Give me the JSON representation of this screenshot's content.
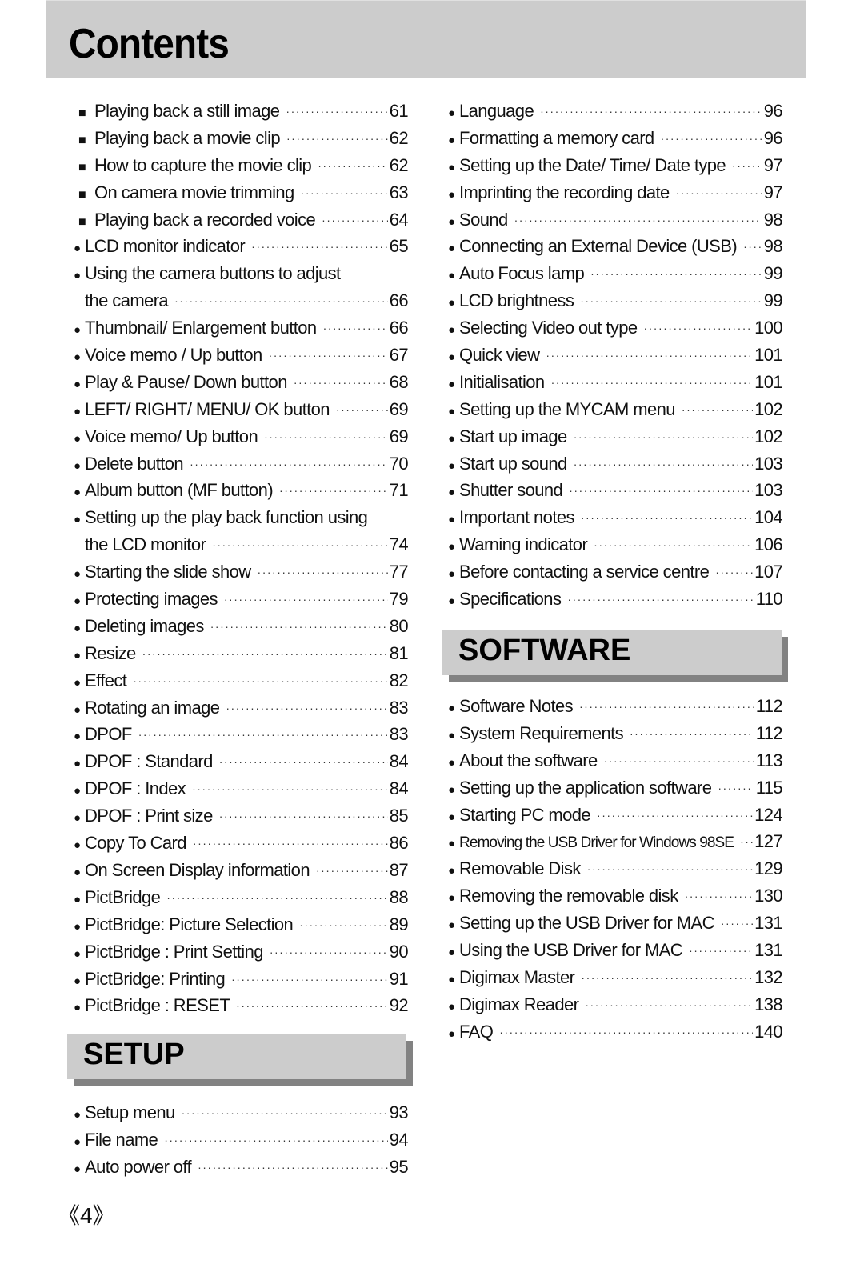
{
  "title": "Contents",
  "left_column": [
    {
      "label": "Playing back a still image",
      "page": "61",
      "bullet": "square"
    },
    {
      "label": "Playing back a movie clip",
      "page": "62",
      "bullet": "square"
    },
    {
      "label": "How to capture the movie clip",
      "page": "62",
      "bullet": "square"
    },
    {
      "label": "On camera movie trimming",
      "page": "63",
      "bullet": "square"
    },
    {
      "label": "Playing back a recorded voice",
      "page": "64",
      "bullet": "square"
    },
    {
      "label": "LCD monitor indicator",
      "page": "65",
      "bullet": "circle"
    },
    {
      "label": "Using the camera buttons to adjust",
      "page": "",
      "bullet": "circle"
    },
    {
      "label": "the camera",
      "page": "66",
      "bullet": "cont"
    },
    {
      "label": "Thumbnail/ Enlargement button",
      "page": "66",
      "bullet": "circle"
    },
    {
      "label": "Voice memo / Up button",
      "page": "67",
      "bullet": "circle"
    },
    {
      "label": "Play & Pause/ Down button",
      "page": "68",
      "bullet": "circle"
    },
    {
      "label": "LEFT/ RIGHT/ MENU/ OK button",
      "page": "69",
      "bullet": "circle"
    },
    {
      "label": "Voice memo/ Up button",
      "page": "69",
      "bullet": "circle"
    },
    {
      "label": "Delete button",
      "page": "70",
      "bullet": "circle"
    },
    {
      "label": "Album button (MF button)",
      "page": "71",
      "bullet": "circle"
    },
    {
      "label": "Setting up the play back function using",
      "page": "",
      "bullet": "circle"
    },
    {
      "label": "the LCD monitor",
      "page": "74",
      "bullet": "cont"
    },
    {
      "label": "Starting the slide show",
      "page": "77",
      "bullet": "circle"
    },
    {
      "label": "Protecting images",
      "page": "79",
      "bullet": "circle"
    },
    {
      "label": "Deleting images",
      "page": "80",
      "bullet": "circle"
    },
    {
      "label": "Resize",
      "page": "81",
      "bullet": "circle"
    },
    {
      "label": "Effect",
      "page": "82",
      "bullet": "circle"
    },
    {
      "label": "Rotating an image",
      "page": "83",
      "bullet": "circle"
    },
    {
      "label": "DPOF",
      "page": "83",
      "bullet": "circle"
    },
    {
      "label": "DPOF : Standard",
      "page": "84",
      "bullet": "circle"
    },
    {
      "label": "DPOF : Index",
      "page": "84",
      "bullet": "circle"
    },
    {
      "label": "DPOF : Print size",
      "page": "85",
      "bullet": "circle"
    },
    {
      "label": "Copy To Card",
      "page": "86",
      "bullet": "circle"
    },
    {
      "label": "On Screen Display information",
      "page": "87",
      "bullet": "circle"
    },
    {
      "label": "PictBridge",
      "page": "88",
      "bullet": "circle"
    },
    {
      "label": "PictBridge: Picture Selection",
      "page": "89",
      "bullet": "circle"
    },
    {
      "label": "PictBridge : Print Setting",
      "page": "90",
      "bullet": "circle"
    },
    {
      "label": "PictBridge: Printing",
      "page": "91",
      "bullet": "circle"
    },
    {
      "label": "PictBridge : RESET",
      "page": "92",
      "bullet": "circle"
    }
  ],
  "setup": {
    "heading": "SETUP",
    "items": [
      {
        "label": "Setup menu",
        "page": "93"
      },
      {
        "label": "File name",
        "page": "94"
      },
      {
        "label": "Auto power off",
        "page": "95"
      }
    ]
  },
  "right_column": [
    {
      "label": "Language",
      "page": "96"
    },
    {
      "label": "Formatting a memory card",
      "page": "96"
    },
    {
      "label": "Setting up the Date/ Time/ Date type",
      "page": "97"
    },
    {
      "label": "Imprinting the recording date",
      "page": "97"
    },
    {
      "label": "Sound",
      "page": "98"
    },
    {
      "label": "Connecting an External Device (USB)",
      "page": "98"
    },
    {
      "label": "Auto Focus lamp",
      "page": "99"
    },
    {
      "label": "LCD brightness",
      "page": "99"
    },
    {
      "label": "Selecting Video out type",
      "page": "100"
    },
    {
      "label": "Quick view",
      "page": "101"
    },
    {
      "label": "Initialisation",
      "page": "101"
    },
    {
      "label": "Setting up the MYCAM menu",
      "page": "102"
    },
    {
      "label": "Start up image",
      "page": "102"
    },
    {
      "label": "Start up sound",
      "page": "103"
    },
    {
      "label": "Shutter sound",
      "page": "103"
    },
    {
      "label": "Important notes",
      "page": "104"
    },
    {
      "label": "Warning indicator",
      "page": "106"
    },
    {
      "label": "Before contacting a service centre",
      "page": "107"
    },
    {
      "label": "Specifications",
      "page": "110"
    }
  ],
  "software": {
    "heading": "SOFTWARE",
    "items": [
      {
        "label": "Software Notes",
        "page": "112"
      },
      {
        "label": "System Requirements",
        "page": "112"
      },
      {
        "label": "About the software",
        "page": "113"
      },
      {
        "label": "Setting up the application software",
        "page": "115"
      },
      {
        "label": "Starting PC mode",
        "page": "124"
      },
      {
        "label": "Removing the USB Driver for Windows 98SE",
        "page": "127",
        "small": true
      },
      {
        "label": "Removable Disk",
        "page": "129"
      },
      {
        "label": "Removing the removable disk",
        "page": "130"
      },
      {
        "label": "Setting up the USB Driver for MAC",
        "page": "131"
      },
      {
        "label": "Using the USB Driver for MAC",
        "page": "131"
      },
      {
        "label": "Digimax Master",
        "page": "132"
      },
      {
        "label": "Digimax Reader",
        "page": "138"
      },
      {
        "label": "FAQ",
        "page": "140"
      }
    ]
  },
  "bullets": {
    "circle": "●",
    "square": "■"
  },
  "page_number": "《4》"
}
